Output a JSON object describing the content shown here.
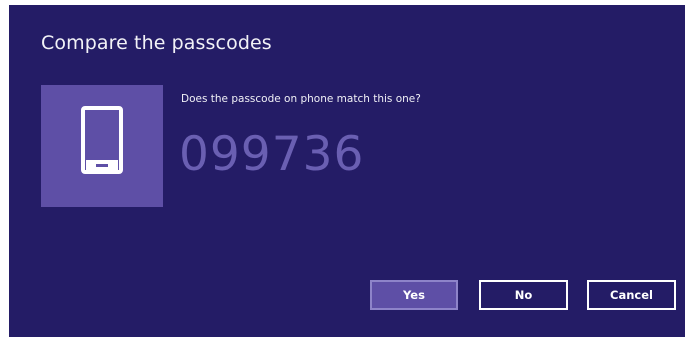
{
  "dialog": {
    "title": "Compare the passcodes",
    "question": "Does the passcode on phone match this one?",
    "passcode": "099736",
    "device_icon": "phone-icon"
  },
  "buttons": {
    "yes_label": "Yes",
    "no_label": "No",
    "cancel_label": "Cancel"
  },
  "colors": {
    "dialog_background": "#241c66",
    "tile_background": "#5e4fa6",
    "passcode_text": "#6a5fb2",
    "primary_button": "#5e4fa6"
  }
}
